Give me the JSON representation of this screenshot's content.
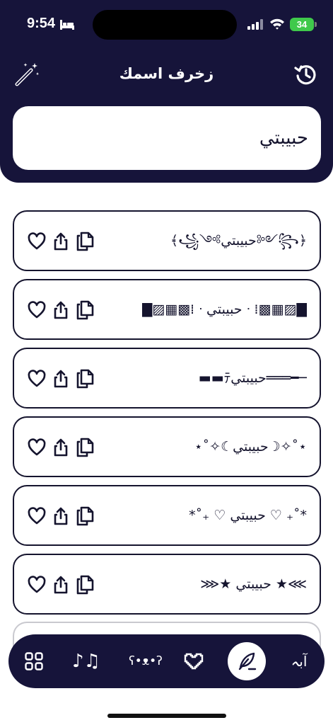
{
  "status": {
    "time": "9:54",
    "battery": "34"
  },
  "header": {
    "title": "زخرف اسمك"
  },
  "name_input": {
    "value": "حبيبتي"
  },
  "styles": [
    {
      "text": "﴾꧁༺حبيبتي༻꧂﴿"
    },
    {
      "text": "▇▨▦▩⁞ ᐧ حبيبتي ᐧ ⁞▩▦▨▇"
    },
    {
      "text": "▬▬ﾃحبيبتي═══━─"
    },
    {
      "text": "⋆˚✧☾حبيبتي☽✧˚⋆"
    },
    {
      "text": "*˚₊ ♡ حبيبتي ♡ ₊˚*"
    },
    {
      "text": "⋙★ حبيبتي ★⋘"
    }
  ],
  "nav": {
    "music": "♪♫",
    "kaomoji": "ʕ•ᴥ•ʔ",
    "letters": "آبہ"
  },
  "colors": {
    "primary": "#16143a",
    "battery": "#3fc94b"
  }
}
